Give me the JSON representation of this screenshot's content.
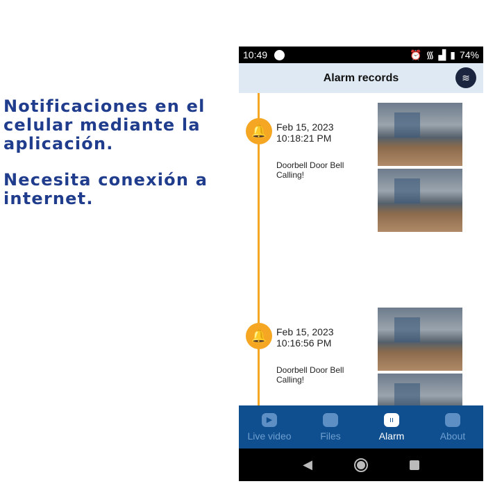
{
  "promo": {
    "line1": "Notificaciones en el celular mediante la aplicación.",
    "line2": "Necesita conexión a internet."
  },
  "status_bar": {
    "time": "10:49",
    "battery": "74%"
  },
  "header": {
    "title": "Alarm records",
    "layers_icon": "layers-icon"
  },
  "records": [
    {
      "date": "Feb 15, 2023",
      "time": "10:18:21 PM",
      "message": "Doorbell   Door Bell Calling!"
    },
    {
      "date": "Feb 15, 2023",
      "time": "10:16:56 PM",
      "message": "Doorbell   Door Bell Calling!"
    }
  ],
  "nav": [
    {
      "label": "Live video",
      "icon": "play-icon"
    },
    {
      "label": "Files",
      "icon": "folder-icon"
    },
    {
      "label": "Alarm",
      "icon": "alarm-icon",
      "active": true
    },
    {
      "label": "About",
      "icon": "puzzle-icon"
    }
  ],
  "colors": {
    "accent": "#f5a623",
    "nav": "#0f4f8f",
    "promo_text": "#203c8c"
  }
}
